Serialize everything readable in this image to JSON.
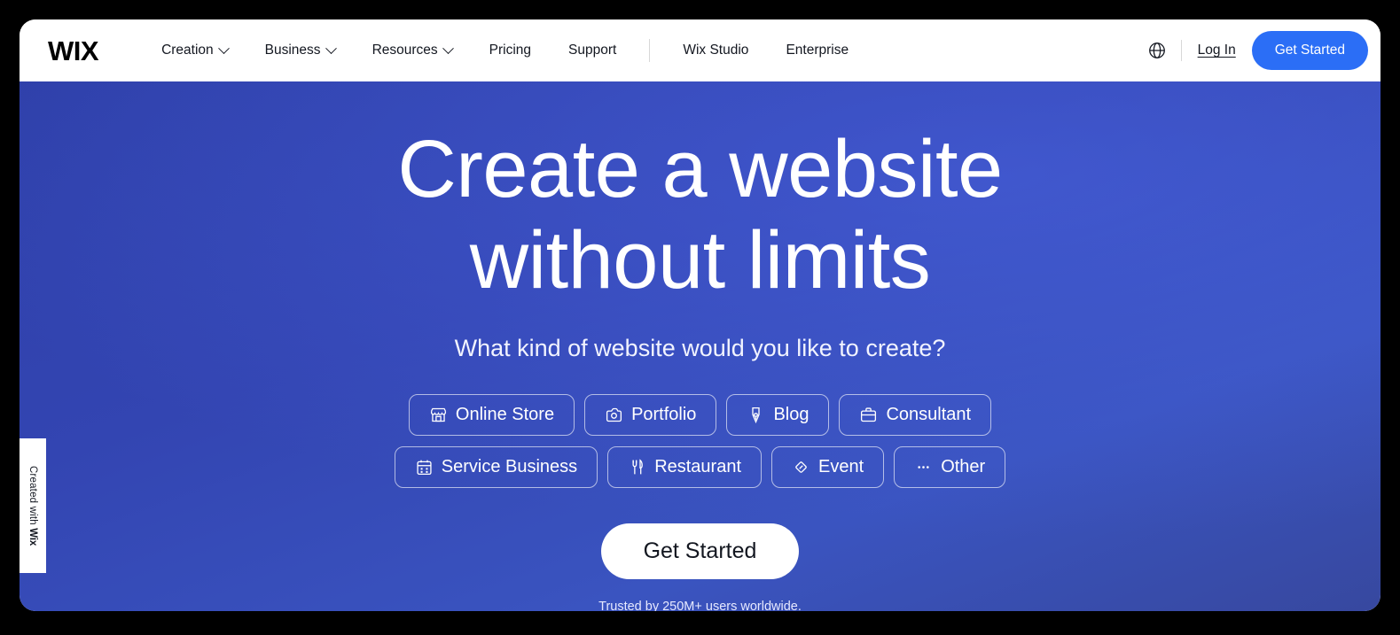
{
  "navbar": {
    "logo": "WIX",
    "links": [
      {
        "label": "Creation",
        "has_dropdown": true
      },
      {
        "label": "Business",
        "has_dropdown": true
      },
      {
        "label": "Resources",
        "has_dropdown": true
      },
      {
        "label": "Pricing",
        "has_dropdown": false
      },
      {
        "label": "Support",
        "has_dropdown": false
      },
      {
        "label": "Wix Studio",
        "has_dropdown": false
      },
      {
        "label": "Enterprise",
        "has_dropdown": false
      }
    ],
    "language_icon": "globe-icon",
    "login_label": "Log In",
    "get_started_label": "Get Started",
    "get_started_color": "#2b6ef6"
  },
  "hero": {
    "title_line_1": "Create a website",
    "title_line_2": "without limits",
    "subtitle": "What kind of website would you like to create?",
    "cta_label": "Get Started",
    "trusted_text": "Trusted by 250M+ users worldwide.",
    "background_from": "#2e3fa8",
    "background_to": "#3a54c0",
    "categories_row_1": [
      {
        "label": "Online Store",
        "icon": "storefront-icon"
      },
      {
        "label": "Portfolio",
        "icon": "image-gallery-icon"
      },
      {
        "label": "Blog",
        "icon": "pen-nib-icon"
      },
      {
        "label": "Consultant",
        "icon": "briefcase-icon"
      }
    ],
    "categories_row_2": [
      {
        "label": "Service Business",
        "icon": "calendar-icon"
      },
      {
        "label": "Restaurant",
        "icon": "fork-knife-icon"
      },
      {
        "label": "Event",
        "icon": "ticket-diamond-icon"
      },
      {
        "label": "Other",
        "icon": "ellipsis-icon"
      }
    ]
  },
  "badge": {
    "prefix": "Created with ",
    "brand": "Wix"
  }
}
